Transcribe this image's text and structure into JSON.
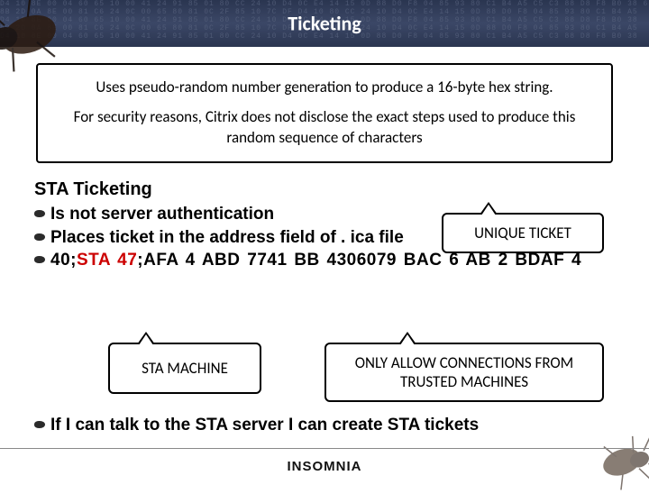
{
  "header": {
    "title": "Ticketing",
    "hex_filler": "D4 10 8E 00 04 60 65 10 00 41 24 91 85 01 80 CC 24 10 D4 0C E4 14 15 0D 88 D0 F8 04 85 93 80 C1 B4 A5 C5 C3 88 D8 F8 B0 38 65 85 19 37 21 E4 65 13 01 80 CF 52 10 84"
  },
  "info_box": {
    "line1": "Uses pseudo-random number generation to produce a 16-byte hex string.",
    "line2": "For security reasons, Citrix does not disclose the exact steps used to produce this random sequence of characters"
  },
  "sta": {
    "heading": "STA Ticketing",
    "bullets": {
      "b1": "Is not server authentication",
      "b2": "Places ticket in the address field of . ica file"
    },
    "ticket": {
      "prefix": "40;",
      "machine": "STA 47",
      "sep": ";",
      "unique": "AFA 4 ABD 7741 BB 4306079 BAC 6 AB 2 BDAF 4"
    },
    "final": "If I can talk to the STA server I can create STA tickets"
  },
  "callouts": {
    "unique": "UNIQUE TICKET",
    "sta_machine": "STA MACHINE",
    "allow": "ONLY ALLOW CONNECTIONS FROM TRUSTED MACHINES"
  },
  "footer": {
    "brand": "INSOMNIA"
  }
}
